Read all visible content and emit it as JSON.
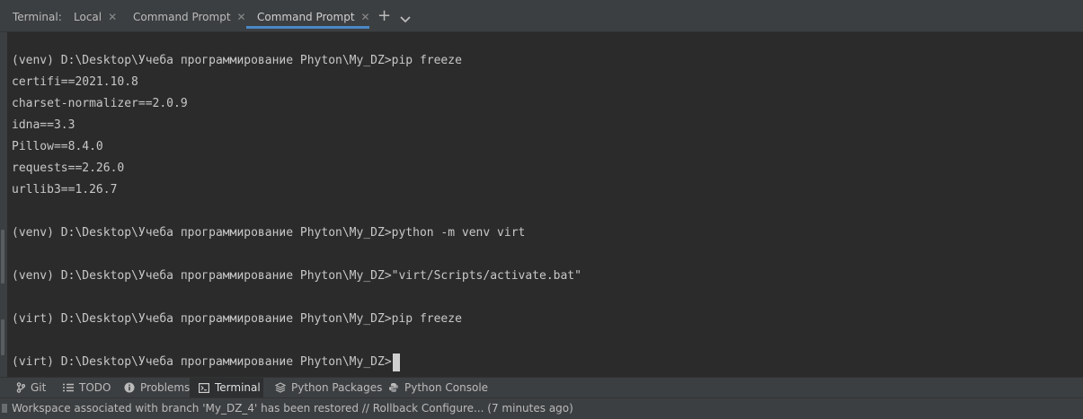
{
  "tabbar": {
    "title": "Terminal:",
    "tabs": [
      {
        "label": "Local"
      },
      {
        "label": "Command Prompt"
      },
      {
        "label": "Command Prompt"
      }
    ],
    "close_glyph": "✕",
    "plus_glyph": "+",
    "icons": {
      "add": "plus-icon",
      "more": "chevron-down-icon",
      "close": "close-icon"
    }
  },
  "terminal": {
    "lines": [
      "(venv) D:\\Desktop\\Учеба программирование Phyton\\My_DZ>pip freeze",
      "certifi==2021.10.8",
      "charset-normalizer==2.0.9",
      "idna==3.3",
      "Pillow==8.4.0",
      "requests==2.26.0",
      "urllib3==1.26.7",
      "",
      "(venv) D:\\Desktop\\Учеба программирование Phyton\\My_DZ>python -m venv virt",
      "",
      "(venv) D:\\Desktop\\Учеба программирование Phyton\\My_DZ>\"virt/Scripts/activate.bat\"",
      "",
      "(virt) D:\\Desktop\\Учеба программирование Phyton\\My_DZ>pip freeze",
      "",
      "(virt) D:\\Desktop\\Учеба программирование Phyton\\My_DZ>"
    ]
  },
  "toolwindows": {
    "git": "Git",
    "todo": "TODO",
    "problems": "Problems",
    "terminal": "Terminal",
    "python_packages": "Python Packages",
    "python_console": "Python Console"
  },
  "status": {
    "message": "Workspace associated with branch 'My_DZ_4' has been restored // Rollback   Configure... (7 minutes ago)"
  },
  "colors": {
    "background": "#2b2b2b",
    "panel": "#3c3f41",
    "accent": "#4a88c7",
    "text": "#c8c8c8"
  }
}
